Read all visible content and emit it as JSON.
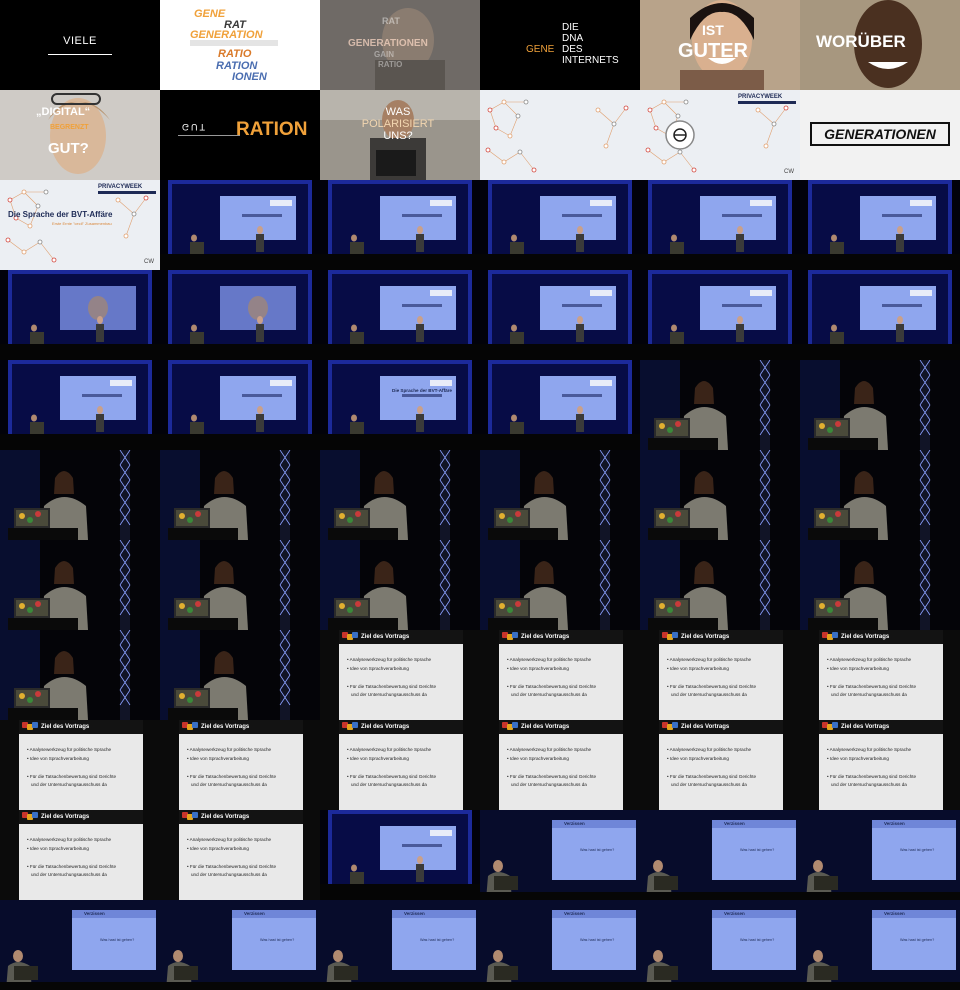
{
  "frames": {
    "viele": "VIELE",
    "gene_words": [
      "GENE",
      "RAT",
      "GENERATION",
      "RATIO",
      "RATION",
      "IONEN"
    ],
    "ghost_words": [
      "RAT",
      "GENERATIONEN",
      "GAIN",
      "RATIO"
    ],
    "dna_words": [
      "DIE",
      "DNA",
      "DES",
      "INTERNETS"
    ],
    "dna_gene": "GENE",
    "ist_guter": [
      "IST",
      "GUTER"
    ],
    "worueber": "WORÜBER",
    "digital_words": [
      "„DIGITAL“",
      "BEGRENZT",
      "GUT?"
    ],
    "ration": "RATION",
    "ration_glitch": "GUT",
    "polarisiert": [
      "WAS",
      "POLARISIERT",
      "UNS?"
    ],
    "privacyweek": "PRIVACYWEEK",
    "generationen": "GENERATIONEN",
    "cw": "CW",
    "talk_title": "Die Sprache der BVT-Affäre",
    "talk_subtitle": "Erste Ernte \"cecil\" Zusammenbau"
  },
  "slide": {
    "title": "Ziel des Vortrags",
    "bullet1": "Analysewerkzeug für politische Sprache",
    "bullet2": "Idee von Sprachverarbeitung",
    "bullet3_line1": "Für die Tatsachenbewertung sind Gerichte",
    "bullet3_line2": "und der Untersuchungsausschuss da"
  },
  "veraisen": {
    "title": "Verzissen",
    "text": "Was hast ist gehen?"
  },
  "colors": {
    "orange": "#f0a13a",
    "blue": "#4a6db0",
    "navy": "#1d2a55",
    "stage_blue": "#1a2fb8",
    "screen": "#8fa6ee",
    "slide_red": "#c8332b"
  },
  "layout_grid": {
    "rows": [
      [
        "viele",
        "gene",
        "ghost",
        "dna",
        "guter",
        "worueber"
      ],
      [
        "digital",
        "ration",
        "polar",
        "privacy",
        "privacy_frame",
        "generationen"
      ],
      [
        "privacy_title",
        "stage_screen",
        "stage_screen",
        "stage_screen",
        "stage_screen",
        "stage_screen"
      ],
      [
        "stage_face",
        "stage_face",
        "stage_screen",
        "stage_screen",
        "stage_screen",
        "stage_screen"
      ],
      [
        "stage_screen",
        "stage_screen",
        "stage_title",
        "stage_mix",
        "speaker",
        "speaker"
      ],
      [
        "speaker",
        "speaker",
        "speaker",
        "speaker",
        "speaker",
        "speaker"
      ],
      [
        "speaker",
        "speaker",
        "speaker",
        "speaker",
        "speaker",
        "speaker"
      ],
      [
        "speaker",
        "speaker",
        "slide",
        "slide",
        "slide",
        "slide"
      ],
      [
        "slide",
        "slide",
        "slide",
        "slide",
        "slide",
        "slide"
      ],
      [
        "slide",
        "slide",
        "stage_bullets",
        "stage_veraisen",
        "stage_veraisen",
        "stage_veraisen"
      ],
      [
        "stage_veraisen",
        "stage_veraisen",
        "stage_veraisen",
        "stage_veraisen",
        "stage_veraisen",
        "stage_veraisen"
      ]
    ]
  }
}
